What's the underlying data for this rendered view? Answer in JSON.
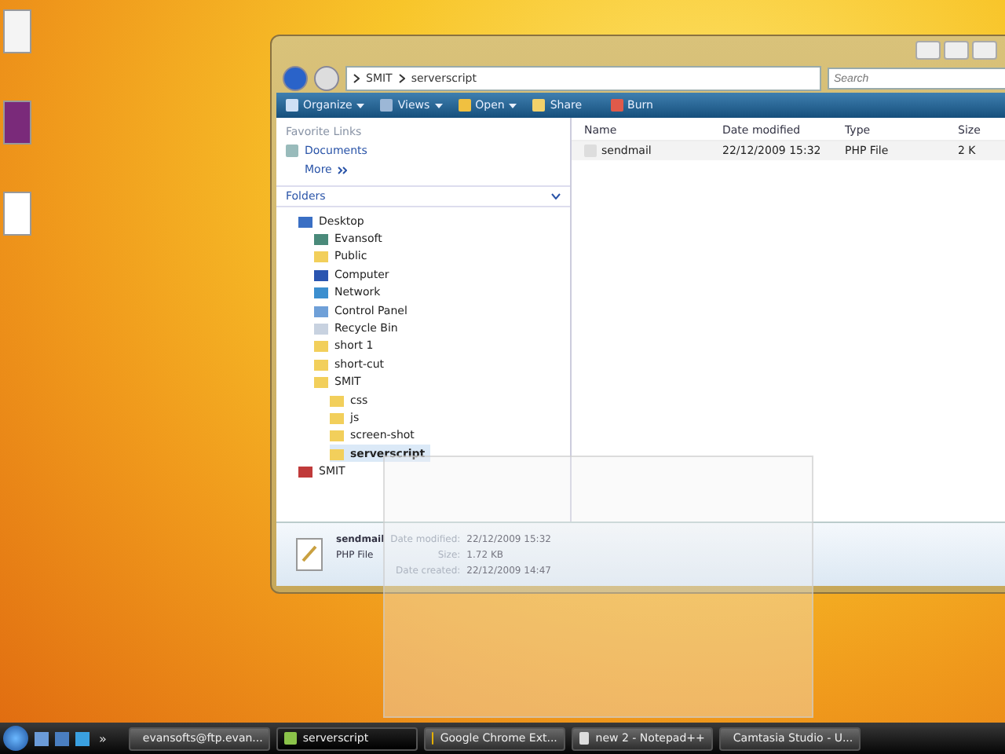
{
  "window": {
    "breadcrumb": [
      "SMIT",
      "serverscript"
    ],
    "search": {
      "placeholder": "Search"
    }
  },
  "toolbar": [
    {
      "label": "Organize",
      "kind": "organize",
      "dropdown": true
    },
    {
      "label": "Views",
      "kind": "views",
      "dropdown": true
    },
    {
      "label": "Open",
      "kind": "open",
      "dropdown": true
    },
    {
      "label": "Share",
      "kind": "share",
      "dropdown": false
    },
    {
      "label": "Burn",
      "kind": "burn",
      "dropdown": false
    }
  ],
  "favorite_links": {
    "title": "Favorite Links",
    "items": [
      "Documents"
    ],
    "more": "More"
  },
  "folders": {
    "title": "Folders",
    "tree": [
      {
        "label": "Desktop",
        "kind": "desktop",
        "selected": false,
        "children": [
          {
            "label": "Evansoft",
            "kind": "user",
            "selected": false
          },
          {
            "label": "Public",
            "kind": "folder",
            "selected": false
          },
          {
            "label": "Computer",
            "kind": "computer",
            "selected": false
          },
          {
            "label": "Network",
            "kind": "network",
            "selected": false
          },
          {
            "label": "Control Panel",
            "kind": "control",
            "selected": false
          },
          {
            "label": "Recycle Bin",
            "kind": "recycle",
            "selected": false
          },
          {
            "label": "short 1",
            "kind": "folder",
            "selected": false
          },
          {
            "label": "short-cut",
            "kind": "folder",
            "selected": false
          },
          {
            "label": "SMIT",
            "kind": "folder",
            "selected": false,
            "children": [
              {
                "label": "css",
                "kind": "folder",
                "selected": false
              },
              {
                "label": "js",
                "kind": "folder",
                "selected": false
              },
              {
                "label": "screen-shot",
                "kind": "folder",
                "selected": false
              },
              {
                "label": "serverscript",
                "kind": "folder",
                "selected": true
              }
            ]
          }
        ]
      },
      {
        "label": "SMIT",
        "kind": "drive",
        "selected": false
      }
    ]
  },
  "table": {
    "columns": [
      "Name",
      "Date modified",
      "Type",
      "Size"
    ],
    "rows": [
      {
        "name": "sendmail",
        "date": "22/12/2009 15:32",
        "type": "PHP File",
        "size": "2 K",
        "selected": false
      }
    ]
  },
  "details": {
    "name": "sendmail",
    "type": "PHP File",
    "fields": [
      {
        "label": "Date modified:",
        "value": "22/12/2009 15:32"
      },
      {
        "label": "Size:",
        "value": "1.72 KB"
      },
      {
        "label": "Date created:",
        "value": "22/12/2009 14:47"
      }
    ]
  },
  "taskbar": {
    "more": "»",
    "tasks": [
      {
        "label": "evansofts@ftp.evan...",
        "kind": "ftp",
        "selected": false
      },
      {
        "label": "serverscript",
        "kind": "folder",
        "selected": true
      },
      {
        "label": "Google Chrome Ext...",
        "kind": "chrome",
        "selected": false
      },
      {
        "label": "new 2 - Notepad++",
        "kind": "notepad",
        "selected": false
      },
      {
        "label": "Camtasia Studio - U...",
        "kind": "camtasia",
        "selected": false
      }
    ]
  }
}
